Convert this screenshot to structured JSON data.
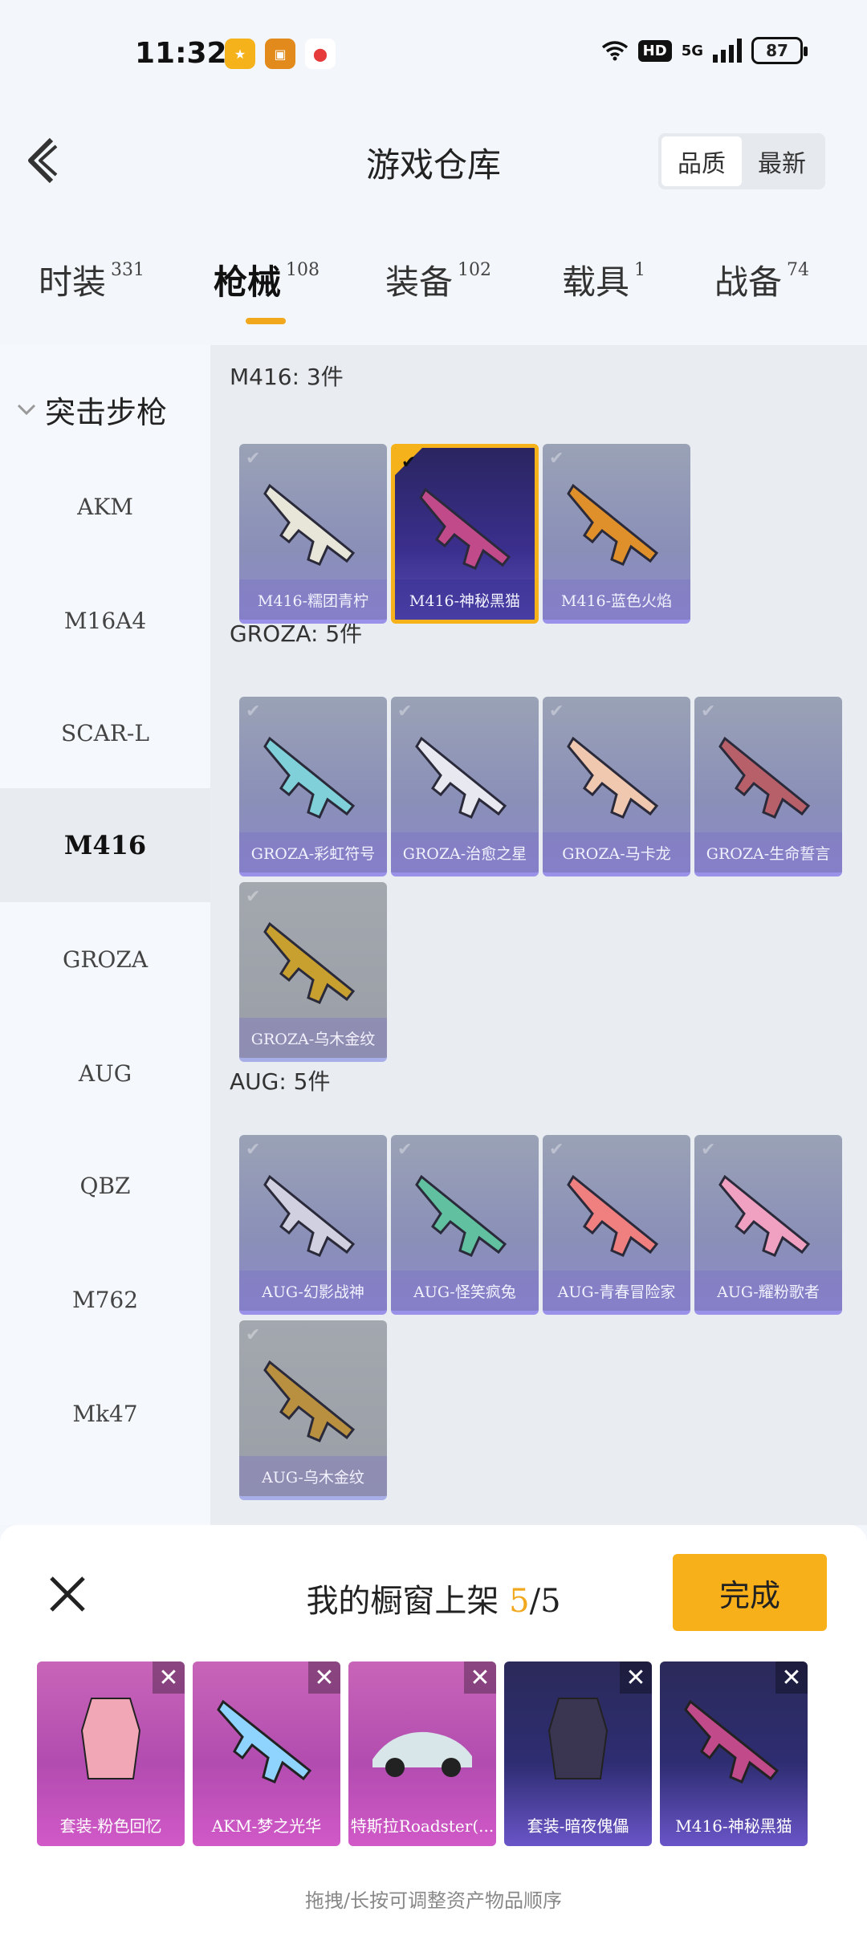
{
  "status_bar": {
    "time": "11:32",
    "battery": "87",
    "network": "5G",
    "hd_badge": "HD",
    "wifi_icon": "wifi-icon",
    "app_icons": [
      {
        "icon": "app-icon-yellow",
        "color": "#f5b21a"
      },
      {
        "icon": "app-icon-game",
        "color": "#e28a1b"
      },
      {
        "icon": "app-icon-map-pin",
        "color": "#e53b3b"
      }
    ]
  },
  "header": {
    "title": "游戏仓库",
    "sort_options": [
      "品质",
      "最新"
    ],
    "active_sort": "品质"
  },
  "tabs": [
    {
      "label": "时装",
      "count": "331"
    },
    {
      "label": "枪械",
      "count": "108",
      "active": true
    },
    {
      "label": "装备",
      "count": "102"
    },
    {
      "label": "载具",
      "count": "1"
    },
    {
      "label": "战备",
      "count": "74"
    }
  ],
  "sidebar": {
    "category": "突击步枪",
    "items": [
      "AKM",
      "M16A4",
      "SCAR-L",
      "M416",
      "GROZA",
      "AUG",
      "QBZ",
      "M762",
      "Mk47"
    ],
    "active": "M416"
  },
  "groups": [
    {
      "title": "M416: 3件",
      "items": [
        {
          "label": "M416-糯团青柠",
          "color": "#e8e6d8"
        },
        {
          "label": "M416-神秘黑猫",
          "color": "#c04a8a",
          "selected": true
        },
        {
          "label": "M416-蓝色火焰",
          "color": "#e0902a"
        }
      ]
    },
    {
      "title": "GROZA: 5件",
      "items": [
        {
          "label": "GROZA-彩虹符号",
          "color": "#7fd0d8"
        },
        {
          "label": "GROZA-治愈之星",
          "color": "#e8e8f0"
        },
        {
          "label": "GROZA-马卡龙",
          "color": "#f0c8b0"
        },
        {
          "label": "GROZA-生命誓言",
          "color": "#b8606a"
        },
        {
          "label": "GROZA-乌木金纹",
          "color": "#c8a030",
          "gray": true
        }
      ]
    },
    {
      "title": "AUG: 5件",
      "items": [
        {
          "label": "AUG-幻影战神",
          "color": "#d0d0e0"
        },
        {
          "label": "AUG-怪笑疯兔",
          "color": "#60c0a0"
        },
        {
          "label": "AUG-青春冒险家",
          "color": "#f08080"
        },
        {
          "label": "AUG-耀粉歌者",
          "color": "#f0a0c0"
        },
        {
          "label": "AUG-乌木金纹",
          "color": "#b89040",
          "gray": true
        }
      ]
    }
  ],
  "panel": {
    "title": "我的橱窗上架",
    "count": "5",
    "total": "/5",
    "done_label": "完成",
    "hint": "拖拽/长按可调整资产物品顺序",
    "showcase": [
      {
        "label": "套装-粉色回忆",
        "style": "pink",
        "art": "outfit-pink"
      },
      {
        "label": "AKM-梦之光华",
        "style": "pink",
        "art": "rifle-akm"
      },
      {
        "label": "特斯拉Roadster(...",
        "style": "pink",
        "art": "car-icon"
      },
      {
        "label": "套装-暗夜傀儡",
        "style": "blue",
        "art": "outfit-dark"
      },
      {
        "label": "M416-神秘黑猫",
        "style": "blue",
        "art": "rifle-m416"
      }
    ]
  }
}
